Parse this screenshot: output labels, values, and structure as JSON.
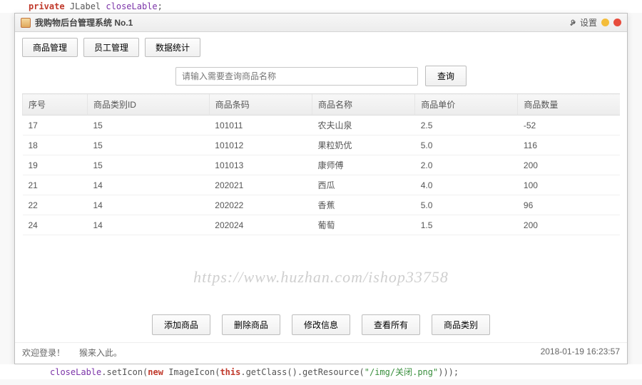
{
  "code_top": {
    "kw": "private",
    "type": "JLabel",
    "ident": "closeLable",
    "semi": ";"
  },
  "titlebar": {
    "title": "我购物后台管理系统 No.1",
    "settings": "设置"
  },
  "tabs": [
    {
      "label": "商品管理"
    },
    {
      "label": "员工管理"
    },
    {
      "label": "数据统计"
    }
  ],
  "search": {
    "placeholder": "请输入需要查询商品名称",
    "button": "查询"
  },
  "table": {
    "headers": [
      "序号",
      "商品类别ID",
      "商品条码",
      "商品名称",
      "商品单价",
      "商品数量"
    ],
    "rows": [
      [
        "17",
        "15",
        "101011",
        "农夫山泉",
        "2.5",
        "-52"
      ],
      [
        "18",
        "15",
        "101012",
        "果粒奶优",
        "5.0",
        "116"
      ],
      [
        "19",
        "15",
        "101013",
        "康师傅",
        "2.0",
        "200"
      ],
      [
        "21",
        "14",
        "202021",
        "西瓜",
        "4.0",
        "100"
      ],
      [
        "22",
        "14",
        "202022",
        "香蕉",
        "5.0",
        "96"
      ],
      [
        "24",
        "14",
        "202024",
        "葡萄",
        "1.5",
        "200"
      ]
    ]
  },
  "watermark": "https://www.huzhan.com/ishop33758",
  "actions": [
    {
      "label": "添加商品"
    },
    {
      "label": "删除商品"
    },
    {
      "label": "修改信息"
    },
    {
      "label": "查看所有"
    },
    {
      "label": "商品类别"
    }
  ],
  "status": {
    "welcome": "欢迎登录！",
    "msg": "猴来入此。",
    "time": "2018-01-19 16:23:57"
  },
  "code_bottom": {
    "obj": "closeLable",
    "method1": ".setIcon(",
    "kw_new": "new",
    "type": " ImageIcon(",
    "kw_this": "this",
    "method2": ".getClass().getResource(",
    "str": "\"/img/关闭.png\"",
    "tail": ")));"
  }
}
